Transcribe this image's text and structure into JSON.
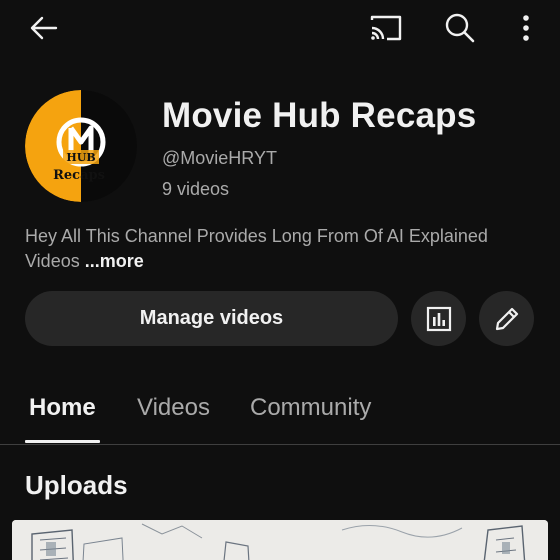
{
  "channel": {
    "name": "Movie Hub Recaps",
    "handle": "@MovieHRYT",
    "video_count": "9 videos",
    "description": "Hey All This Channel Provides Long From Of AI Explained Videos",
    "more_label": "...more",
    "avatar": {
      "letter": "M",
      "word_top": "HUB",
      "word_bottom": "Recaps",
      "colors": {
        "left": "#f5a30f",
        "right": "#0a0a0a"
      }
    }
  },
  "actions": {
    "manage_label": "Manage videos",
    "analytics_icon": "analytics-icon",
    "edit_icon": "pencil-icon"
  },
  "toolbar": {
    "back_icon": "back-arrow-icon",
    "cast_icon": "cast-icon",
    "search_icon": "search-icon",
    "more_icon": "more-vertical-icon"
  },
  "tabs": [
    {
      "label": "Home",
      "active": true
    },
    {
      "label": "Videos",
      "active": false
    },
    {
      "label": "Community",
      "active": false
    }
  ],
  "sections": {
    "uploads_title": "Uploads"
  },
  "colors": {
    "background": "#0f0f0f",
    "button_bg": "#272727",
    "text_primary": "#f1f1f1",
    "text_secondary": "#aaaaaa",
    "divider": "#3f3f3f"
  }
}
